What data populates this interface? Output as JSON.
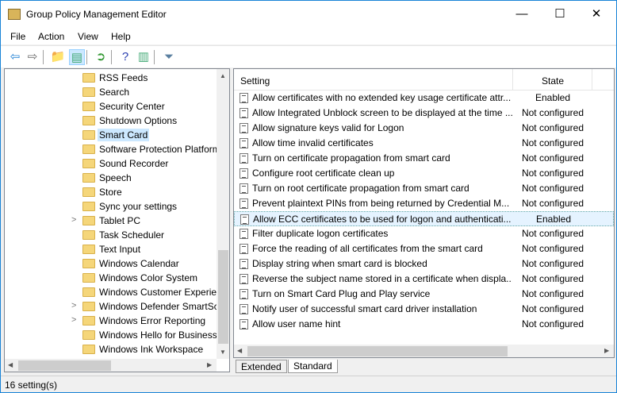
{
  "window": {
    "title": "Group Policy Management Editor",
    "minimize": "—",
    "maximize": "☐",
    "close": "✕"
  },
  "menu": [
    "File",
    "Action",
    "View",
    "Help"
  ],
  "toolbar": [
    {
      "icon": "back-icon",
      "glyph": "⇦",
      "color": "#1e7fd4"
    },
    {
      "icon": "forward-icon",
      "glyph": "⇨",
      "color": "#666"
    },
    {
      "icon": "up-folder-icon",
      "glyph": "📁",
      "color": "#c9a23a"
    },
    {
      "icon": "show-hide-tree-icon",
      "glyph": "▤",
      "color": "#4a7"
    },
    {
      "icon": "export-list-icon",
      "glyph": "➲",
      "color": "#393"
    },
    {
      "icon": "help-icon",
      "glyph": "?",
      "color": "#2a3fb0"
    },
    {
      "icon": "show-action-pane-icon",
      "glyph": "▥",
      "color": "#4a7"
    },
    {
      "icon": "filter-icon",
      "glyph": "⏷",
      "color": "#5a7fa0"
    }
  ],
  "tree": [
    {
      "label": "RSS Feeds"
    },
    {
      "label": "Search"
    },
    {
      "label": "Security Center"
    },
    {
      "label": "Shutdown Options"
    },
    {
      "label": "Smart Card",
      "selected": true
    },
    {
      "label": "Software Protection Platform"
    },
    {
      "label": "Sound Recorder"
    },
    {
      "label": "Speech"
    },
    {
      "label": "Store"
    },
    {
      "label": "Sync your settings"
    },
    {
      "label": "Tablet PC",
      "expandable": true
    },
    {
      "label": "Task Scheduler"
    },
    {
      "label": "Text Input"
    },
    {
      "label": "Windows Calendar"
    },
    {
      "label": "Windows Color System"
    },
    {
      "label": "Windows Customer Experience"
    },
    {
      "label": "Windows Defender SmartScreen",
      "expandable": true
    },
    {
      "label": "Windows Error Reporting",
      "expandable": true
    },
    {
      "label": "Windows Hello for Business"
    },
    {
      "label": "Windows Ink Workspace"
    }
  ],
  "table": {
    "headers": [
      "Setting",
      "State"
    ],
    "rows": [
      [
        "Allow certificates with no extended key usage certificate attr...",
        "Enabled"
      ],
      [
        "Allow Integrated Unblock screen to be displayed at the time ...",
        "Not configured"
      ],
      [
        "Allow signature keys valid for Logon",
        "Not configured"
      ],
      [
        "Allow time invalid certificates",
        "Not configured"
      ],
      [
        "Turn on certificate propagation from smart card",
        "Not configured"
      ],
      [
        "Configure root certificate clean up",
        "Not configured"
      ],
      [
        "Turn on root certificate propagation from smart card",
        "Not configured"
      ],
      [
        "Prevent plaintext PINs from being returned by Credential M...",
        "Not configured"
      ],
      [
        "Allow ECC certificates to be used for logon and authenticati...",
        "Enabled"
      ],
      [
        "Filter duplicate logon certificates",
        "Not configured"
      ],
      [
        "Force the reading of all certificates from the smart card",
        "Not configured"
      ],
      [
        "Display string when smart card is blocked",
        "Not configured"
      ],
      [
        "Reverse the subject name stored in a certificate when displa...",
        "Not configured"
      ],
      [
        "Turn on Smart Card Plug and Play service",
        "Not configured"
      ],
      [
        "Notify user of successful smart card driver installation",
        "Not configured"
      ],
      [
        "Allow user name hint",
        "Not configured"
      ]
    ],
    "selected_row": 8
  },
  "tabs": [
    "Extended",
    "Standard"
  ],
  "status": "16 setting(s)"
}
